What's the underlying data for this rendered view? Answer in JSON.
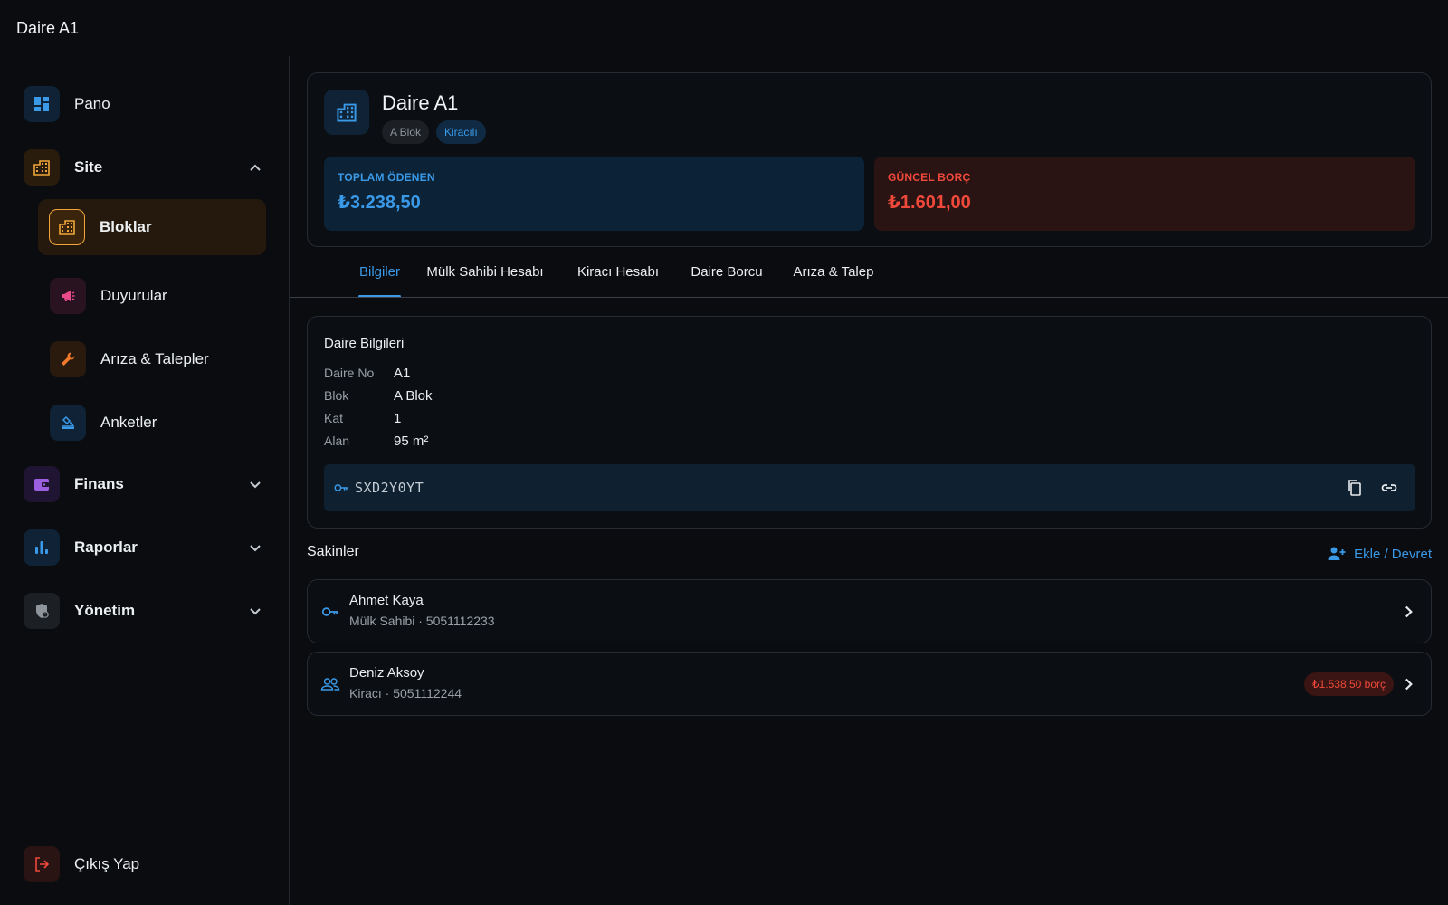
{
  "appbar": {
    "title": "Daire A1"
  },
  "sidebar": {
    "items": [
      {
        "label": "Pano"
      },
      {
        "label": "Site"
      },
      {
        "label": "Bloklar"
      },
      {
        "label": "Duyurular"
      },
      {
        "label": "Arıza & Talepler"
      },
      {
        "label": "Anketler"
      },
      {
        "label": "Finans"
      },
      {
        "label": "Raporlar"
      },
      {
        "label": "Yönetim"
      }
    ],
    "logout": "Çıkış Yap"
  },
  "apartment": {
    "title": "Daire A1",
    "chips": {
      "block": "A Blok",
      "status": "Kiracılı"
    },
    "stats": {
      "paid_label": "TOPLAM ÖDENEN",
      "paid_value": "₺3.238,50",
      "debt_label": "GÜNCEL BORÇ",
      "debt_value": "₺1.601,00"
    }
  },
  "tabs": [
    {
      "label": "Bilgiler",
      "active": true
    },
    {
      "label": "Mülk Sahibi Hesabı"
    },
    {
      "label": "Kiracı Hesabı"
    },
    {
      "label": "Daire Borcu"
    },
    {
      "label": "Arıza & Talep"
    }
  ],
  "info": {
    "title": "Daire Bilgileri",
    "rows": [
      {
        "key": "Daire No",
        "value": "A1"
      },
      {
        "key": "Blok",
        "value": "A Blok"
      },
      {
        "key": "Kat",
        "value": "1"
      },
      {
        "key": "Alan",
        "value": "95 m²"
      }
    ],
    "code": "SXD2Y0YT"
  },
  "residents": {
    "title": "Sakinler",
    "add_label": "Ekle / Devret",
    "items": [
      {
        "name": "Ahmet Kaya",
        "sub": "Mülk Sahibi · 5051112233",
        "icon": "key-icon"
      },
      {
        "name": "Deniz Aksoy",
        "sub": "Kiracı · 5051112244",
        "icon": "people-icon",
        "badge": "₺1.538,50 borç"
      }
    ]
  },
  "colors": {
    "accent": "#3b9ae8",
    "danger": "#f0493b",
    "site_orange": "#f0a63a",
    "announce_pink": "#e84a8a",
    "finance_purple": "#9c5fe0"
  }
}
